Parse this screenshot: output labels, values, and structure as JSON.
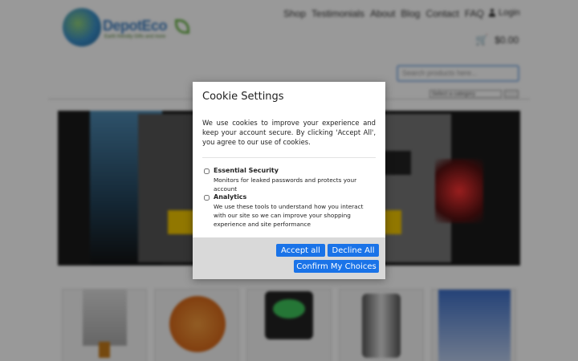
{
  "header": {
    "logo_name": "DepotEco",
    "logo_tagline": "Earth friendly Gifts and more",
    "nav": [
      "Shop",
      "Testimonials",
      "About",
      "Blog",
      "Contact",
      "FAQ"
    ],
    "login_label": "Login",
    "cart_total": "$0.00"
  },
  "search": {
    "placeholder": "Search products here...",
    "category_placeholder": "Select a category"
  },
  "modal": {
    "title": "Cookie Settings",
    "body": "We use cookies to improve your experience and keep your account secure. By clicking 'Accept All', you agree to our use of cookies.",
    "options": [
      {
        "title": "Essential Security",
        "description": "Monitors for leaked passwords and protects your account",
        "checked": false
      },
      {
        "title": "Analytics",
        "description": "We use these tools to understand how you interact with our site so we can improve your shopping experience and site performance",
        "checked": false
      }
    ],
    "buttons": {
      "accept": "Accept all",
      "decline": "Decline All",
      "confirm": "Confirm My Choices"
    },
    "accent_color": "#1a73e8"
  },
  "icons": {
    "login": "user-icon",
    "cart": "cart-icon"
  }
}
